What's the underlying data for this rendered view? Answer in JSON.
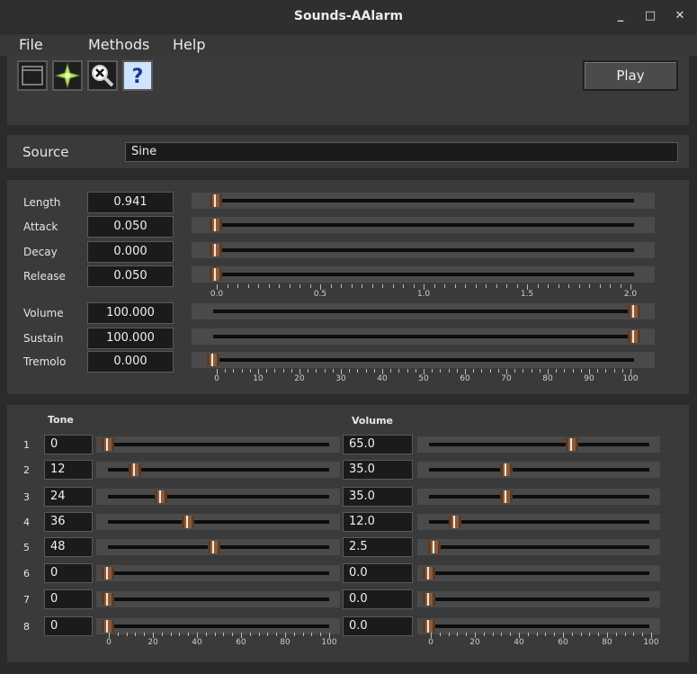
{
  "window": {
    "title": "Sounds-AAlarm",
    "minimize": "_",
    "maximize": "□",
    "close": "✕"
  },
  "menu": {
    "file": "File",
    "methods": "Methods",
    "help": "Help"
  },
  "toolbar": {
    "icons": [
      "window-icon",
      "sparkle-icon",
      "search-clear-icon",
      "help-icon"
    ],
    "play": "Play"
  },
  "source": {
    "label": "Source",
    "value": "Sine"
  },
  "envelope": {
    "rows": [
      {
        "label": "Length",
        "value": "0.941",
        "fraction": 0.0
      },
      {
        "label": "Attack",
        "value": "0.050",
        "fraction": 0.0
      },
      {
        "label": "Decay",
        "value": "0.000",
        "fraction": 0.0
      },
      {
        "label": "Release",
        "value": "0.050",
        "fraction": 0.0
      }
    ],
    "axis": [
      "0.0",
      "0.5",
      "1.0",
      "1.5",
      "2.0"
    ]
  },
  "levels": {
    "rows": [
      {
        "label": "Volume",
        "value": "100.000",
        "fraction": 1.0
      },
      {
        "label": "Sustain",
        "value": "100.000",
        "fraction": 1.0
      },
      {
        "label": "Tremolo",
        "value": "0.000",
        "fraction": 0.0
      }
    ],
    "axis": [
      "0",
      "10",
      "20",
      "30",
      "40",
      "50",
      "60",
      "70",
      "80",
      "90",
      "100"
    ]
  },
  "harmonics": {
    "tone_header": "Tone",
    "volume_header": "Volume",
    "rows": [
      {
        "index": "1",
        "tone": "0",
        "tone_fraction": 0.0,
        "volume": "65.0",
        "volume_fraction": 0.65
      },
      {
        "index": "2",
        "tone": "12",
        "tone_fraction": 0.12,
        "volume": "35.0",
        "volume_fraction": 0.35
      },
      {
        "index": "3",
        "tone": "24",
        "tone_fraction": 0.24,
        "volume": "35.0",
        "volume_fraction": 0.35
      },
      {
        "index": "4",
        "tone": "36",
        "tone_fraction": 0.36,
        "volume": "12.0",
        "volume_fraction": 0.12
      },
      {
        "index": "5",
        "tone": "48",
        "tone_fraction": 0.48,
        "volume": "2.5",
        "volume_fraction": 0.025
      },
      {
        "index": "6",
        "tone": "0",
        "tone_fraction": 0.0,
        "volume": "0.0",
        "volume_fraction": 0.0
      },
      {
        "index": "7",
        "tone": "0",
        "tone_fraction": 0.0,
        "volume": "0.0",
        "volume_fraction": 0.0
      },
      {
        "index": "8",
        "tone": "0",
        "tone_fraction": 0.0,
        "volume": "0.0",
        "volume_fraction": 0.0
      }
    ],
    "axis": [
      "0",
      "20",
      "40",
      "60",
      "80",
      "100"
    ]
  }
}
